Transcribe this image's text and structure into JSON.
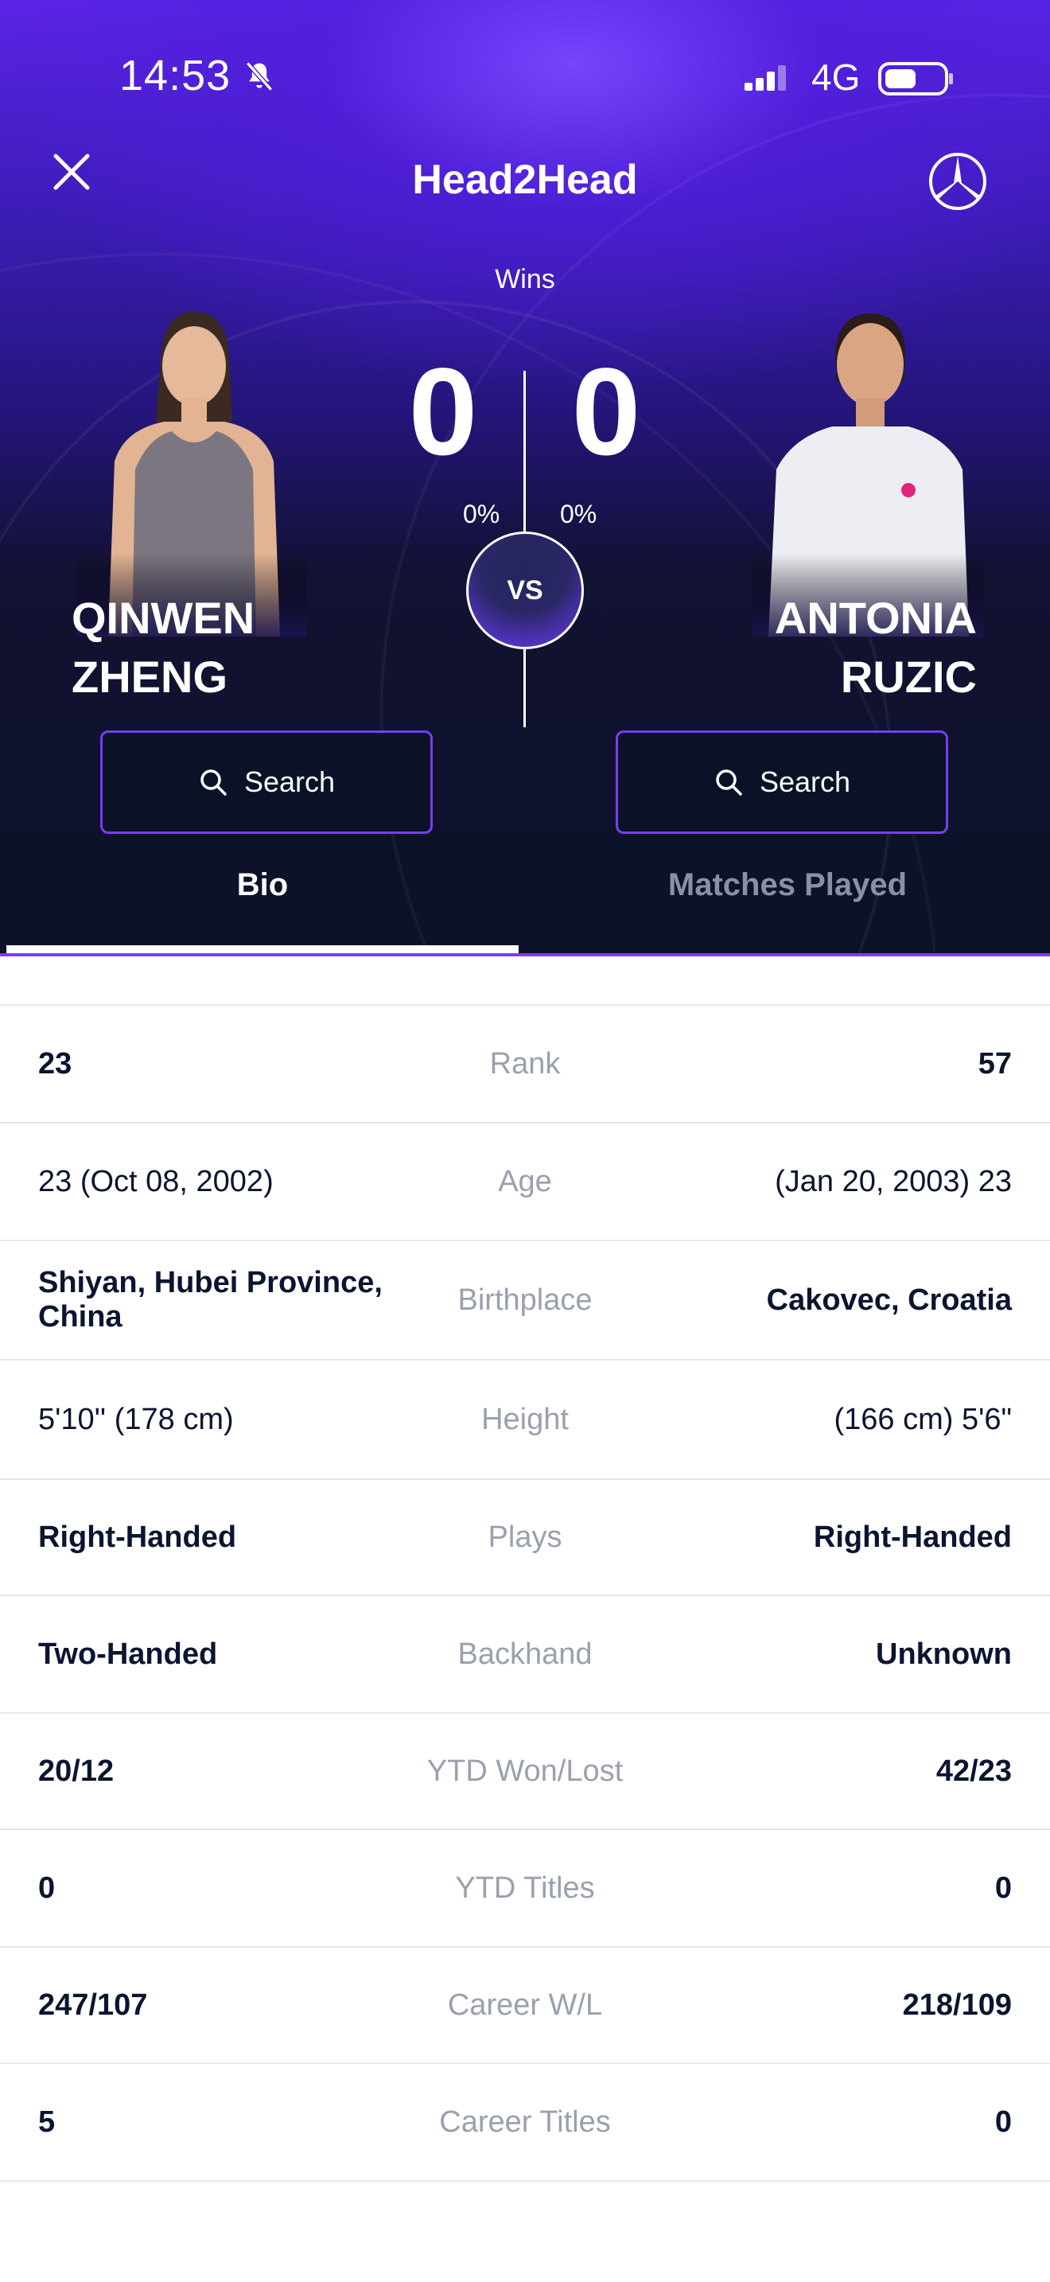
{
  "status_bar": {
    "time": "14:53",
    "network": "4G"
  },
  "header": {
    "title": "Head2Head",
    "wins_label": "Wins"
  },
  "score": {
    "left": "0",
    "right": "0",
    "left_pct": "0%",
    "right_pct": "0%",
    "vs": "VS"
  },
  "players": {
    "left": {
      "first": "QINWEN",
      "last": "ZHENG",
      "search_label": "Search"
    },
    "right": {
      "first": "ANTONIA",
      "last": "RUZIC",
      "search_label": "Search"
    }
  },
  "tabs": [
    {
      "label": "Bio",
      "active": true
    },
    {
      "label": "Matches Played",
      "active": false
    }
  ],
  "bio_rows": [
    {
      "label": "Rank",
      "left": "23",
      "right": "57"
    },
    {
      "label": "Age",
      "left": "23 (Oct 08, 2002)",
      "right": "(Jan 20, 2003) 23"
    },
    {
      "label": "Birthplace",
      "left": "Shiyan, Hubei Province, China",
      "right": "Cakovec, Croatia"
    },
    {
      "label": "Height",
      "left": "5'10'' (178 cm)",
      "right": "(166 cm) 5'6\""
    },
    {
      "label": "Plays",
      "left": "Right-Handed",
      "right": "Right-Handed"
    },
    {
      "label": "Backhand",
      "left": "Two-Handed",
      "right": "Unknown"
    },
    {
      "label": "YTD Won/Lost",
      "left": "20/12",
      "right": "42/23"
    },
    {
      "label": "YTD Titles",
      "left": "0",
      "right": "0"
    },
    {
      "label": "Career W/L",
      "left": "247/107",
      "right": "218/109"
    },
    {
      "label": "Career Titles",
      "left": "5",
      "right": "0"
    }
  ],
  "colors": {
    "accent": "#7a3df0",
    "header_dark": "#0b1228",
    "header_purple": "#5a24e6",
    "label_gray": "#9aa0ad",
    "text_dark": "#0b1530"
  },
  "icons": [
    "close-icon",
    "brand-logo-icon",
    "bell-off-icon",
    "signal-icon",
    "battery-icon",
    "search-icon"
  ]
}
